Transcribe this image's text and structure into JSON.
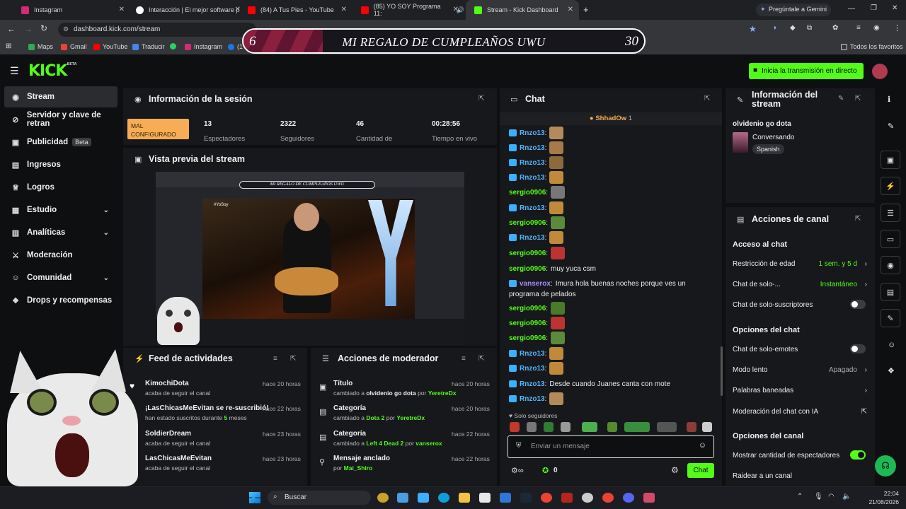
{
  "browser": {
    "tabs": [
      {
        "label": "Instagram",
        "color": "#d62976"
      },
      {
        "label": "Interacción | El mejor software p",
        "color": "#ffffff"
      },
      {
        "label": "(84) A Tus Pies - YouTube",
        "color": "#ff0000"
      },
      {
        "label": "(85) YO SOY Programa 11:",
        "color": "#ff0000"
      },
      {
        "label": "Stream - Kick Dashboard",
        "color": "#53fc18"
      }
    ],
    "gemini": "Pregúntale a Gemini",
    "url": "dashboard.kick.com/stream",
    "bookmarks": [
      "Maps",
      "Gmail",
      "YouTube",
      "Traducir",
      "Instagram",
      "(1"
    ],
    "all_favorites": "Todos los favoritos"
  },
  "banner": {
    "left": "6",
    "title": "MI REGALO DE CUMPLEAÑOS UWU",
    "right": "30"
  },
  "header": {
    "logo": "KICK",
    "logo_tag": "BETA",
    "go_live": "Inicia la transmisión en directo"
  },
  "sidebar": {
    "items": [
      {
        "label": "Stream",
        "icon": "broadcast-icon"
      },
      {
        "label": "Servidor y clave de retran",
        "icon": "link-icon"
      },
      {
        "label": "Publicidad",
        "icon": "ad-icon",
        "badge": "Beta"
      },
      {
        "label": "Ingresos",
        "icon": "wallet-icon"
      },
      {
        "label": "Logros",
        "icon": "trophy-icon"
      },
      {
        "label": "Estudio",
        "icon": "studio-icon"
      },
      {
        "label": "Analíticas",
        "icon": "analytics-icon"
      },
      {
        "label": "Moderación",
        "icon": "sword-icon"
      },
      {
        "label": "Comunidad",
        "icon": "community-icon"
      },
      {
        "label": "Drops y recompensas",
        "icon": "gift-icon"
      }
    ]
  },
  "session": {
    "title": "Información de la sesión",
    "status": "MAL CONFIGURADO",
    "stats": [
      {
        "value": "13",
        "label": "Espectadores"
      },
      {
        "value": "2322",
        "label": "Seguidores"
      },
      {
        "value": "46",
        "label": "Cantidad de"
      },
      {
        "value": "00:28:56",
        "label": "Tiempo en vivo"
      }
    ]
  },
  "preview": {
    "title": "Vista previa del stream",
    "overlay_title": "MI REGALO DE CUMPLEAÑOS UWU",
    "hashtag": "#YoSoy"
  },
  "feed": {
    "title": "Feed de actividades",
    "items": [
      {
        "name": "KimochiDota",
        "sub": "acaba de seguir el canal",
        "time": "hace 20 horas"
      },
      {
        "name": "¡LasChicasMeEvitan se re-suscribió!",
        "sub": "han estado suscritos durante",
        "months": "5",
        "months_label": "meses",
        "time": "hace 22 horas"
      },
      {
        "name": "SoldierDream",
        "sub": "acaba de seguir el canal",
        "time": "hace 23 horas"
      },
      {
        "name": "LasChicasMeEvitan",
        "sub": "acaba de seguir el canal",
        "time": "hace 23 horas"
      }
    ]
  },
  "mod": {
    "title": "Acciones de moderador",
    "items": [
      {
        "name": "Título",
        "pre": "cambiado a",
        "target": "olvidenio go dota",
        "by": "por",
        "user": "YeretreDx",
        "time": "hace 20 horas"
      },
      {
        "name": "Categoría",
        "pre": "cambiado a",
        "target": "Dota 2",
        "by": "por",
        "user": "YeretreDx",
        "time": "hace 20 horas"
      },
      {
        "name": "Categoría",
        "pre": "cambiado a",
        "target": "Left 4 Dead 2",
        "by": "por",
        "user": "vanserox",
        "time": "hace 22 horas"
      },
      {
        "name": "Mensaje anclado",
        "by": "por",
        "user": "Mai_Shiro",
        "time": "hace 22 horas"
      }
    ]
  },
  "chat": {
    "title": "Chat",
    "pinned_user": "ShhadOw",
    "pinned_count": "1",
    "messages": [
      {
        "user": "Rnzo13",
        "text": "",
        "cls": "blue",
        "badge": true
      },
      {
        "user": "Rnzo13",
        "text": "",
        "cls": "blue",
        "badge": true
      },
      {
        "user": "Rnzo13",
        "text": "",
        "cls": "blue",
        "badge": true
      },
      {
        "user": "Rnzo13",
        "text": "",
        "cls": "blue",
        "badge": true
      },
      {
        "user": "sergio0906",
        "text": "",
        "cls": "green",
        "badge": false
      },
      {
        "user": "Rnzo13",
        "text": "",
        "cls": "blue",
        "badge": true
      },
      {
        "user": "sergio0906",
        "text": "",
        "cls": "green",
        "badge": false
      },
      {
        "user": "Rnzo13",
        "text": "",
        "cls": "blue",
        "badge": true
      },
      {
        "user": "sergio0906",
        "text": "",
        "cls": "green",
        "badge": false
      },
      {
        "user": "sergio0906",
        "text": "muy yuca csm",
        "cls": "green",
        "badge": false
      },
      {
        "user": "vanserox",
        "text": "Imura hola buenas noches porque ves un",
        "cls": "purple",
        "badge": true
      },
      {
        "user": "",
        "text": "programa de pelados",
        "cls": "",
        "badge": false
      },
      {
        "user": "sergio0906",
        "text": "",
        "cls": "green",
        "badge": false
      },
      {
        "user": "sergio0906",
        "text": "",
        "cls": "green",
        "badge": false
      },
      {
        "user": "sergio0906",
        "text": "",
        "cls": "green",
        "badge": false
      },
      {
        "user": "Rnzo13",
        "text": "",
        "cls": "blue",
        "badge": true
      },
      {
        "user": "Rnzo13",
        "text": "",
        "cls": "blue",
        "badge": true
      },
      {
        "user": "Rnzo13",
        "text": "Desde cuando Juanes canta con mote",
        "cls": "blue",
        "badge": true
      },
      {
        "user": "Rnzo13",
        "text": "",
        "cls": "blue",
        "badge": true
      }
    ],
    "followers_only": "Solo seguidores",
    "placeholder": "Enviar un mensaje",
    "points": "0",
    "send": "Chat"
  },
  "stream_info": {
    "title": "Información del stream",
    "stream_title": "olvidenio go dota",
    "category": "Conversando",
    "language": "Spanish"
  },
  "channel": {
    "title": "Acciones de canal",
    "access_heading": "Acceso al chat",
    "age_label": "Restricción de edad",
    "age_value": "1 sem. y 5 d",
    "solo_label": "Chat de solo-...",
    "solo_value": "Instantáneo",
    "subs_label": "Chat de solo-suscriptores",
    "chat_options_heading": "Opciones del chat",
    "emotes_label": "Chat de solo-emotes",
    "slow_label": "Modo lento",
    "slow_value": "Apagado",
    "banned_label": "Palabras baneadas",
    "ai_label": "Moderación del chat con IA",
    "channel_options_heading": "Opciones del canal",
    "viewers_label": "Mostrar cantidad de espectadores",
    "raid_label": "Raidear a un canal"
  },
  "taskbar": {
    "search": "Buscar",
    "time": "22:04",
    "date": "21/08/2026"
  },
  "colors": {
    "accent": "#53fc18",
    "bg": "#0e0f11",
    "panel": "#17181b"
  }
}
